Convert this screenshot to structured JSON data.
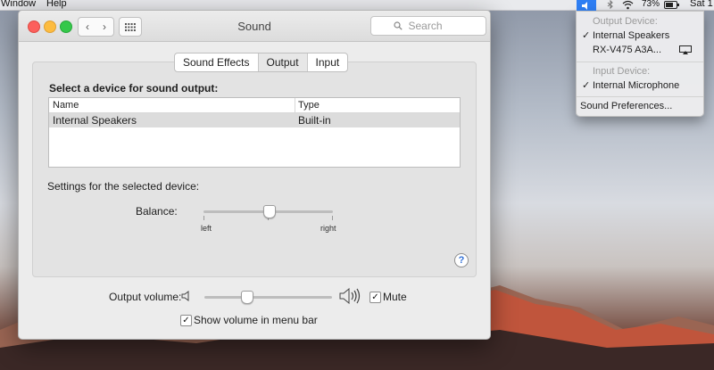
{
  "menubar": {
    "left_items": [
      "Window",
      "Help"
    ],
    "battery_percent": "73%",
    "clock": "Sat 1",
    "icons": [
      "volume-icon",
      "bluetooth-icon",
      "wifi-icon",
      "battery-icon"
    ]
  },
  "window": {
    "title": "Sound",
    "search_placeholder": "Search",
    "tabs": [
      {
        "label": "Sound Effects",
        "selected": false
      },
      {
        "label": "Output",
        "selected": true
      },
      {
        "label": "Input",
        "selected": false
      }
    ],
    "output": {
      "heading": "Select a device for sound output:",
      "columns": [
        "Name",
        "Type"
      ],
      "rows": [
        {
          "name": "Internal Speakers",
          "type": "Built-in",
          "selected": true
        }
      ],
      "settings_label": "Settings for the selected device:",
      "balance_label": "Balance:",
      "balance_value": 0.5,
      "balance_left": "left",
      "balance_right": "right"
    },
    "help": "?",
    "output_volume_label": "Output volume:",
    "output_volume_value": 0.33,
    "mute_label": "Mute",
    "mute_checked": true,
    "show_volume_label": "Show volume in menu bar",
    "show_volume_checked": true
  },
  "volume_menu": {
    "output_header": "Output Device:",
    "output_devices": [
      {
        "label": "Internal Speakers",
        "checked": true
      },
      {
        "label": "RX-V475 A3A...",
        "checked": false,
        "icon": "airplay-icon"
      }
    ],
    "input_header": "Input Device:",
    "input_devices": [
      {
        "label": "Internal Microphone",
        "checked": true
      }
    ],
    "preferences": "Sound Preferences..."
  },
  "colors": {
    "accent": "#2e7ef3",
    "traffic_red": "#fc605c",
    "traffic_yellow": "#fdbc40",
    "traffic_green": "#34c84a"
  }
}
